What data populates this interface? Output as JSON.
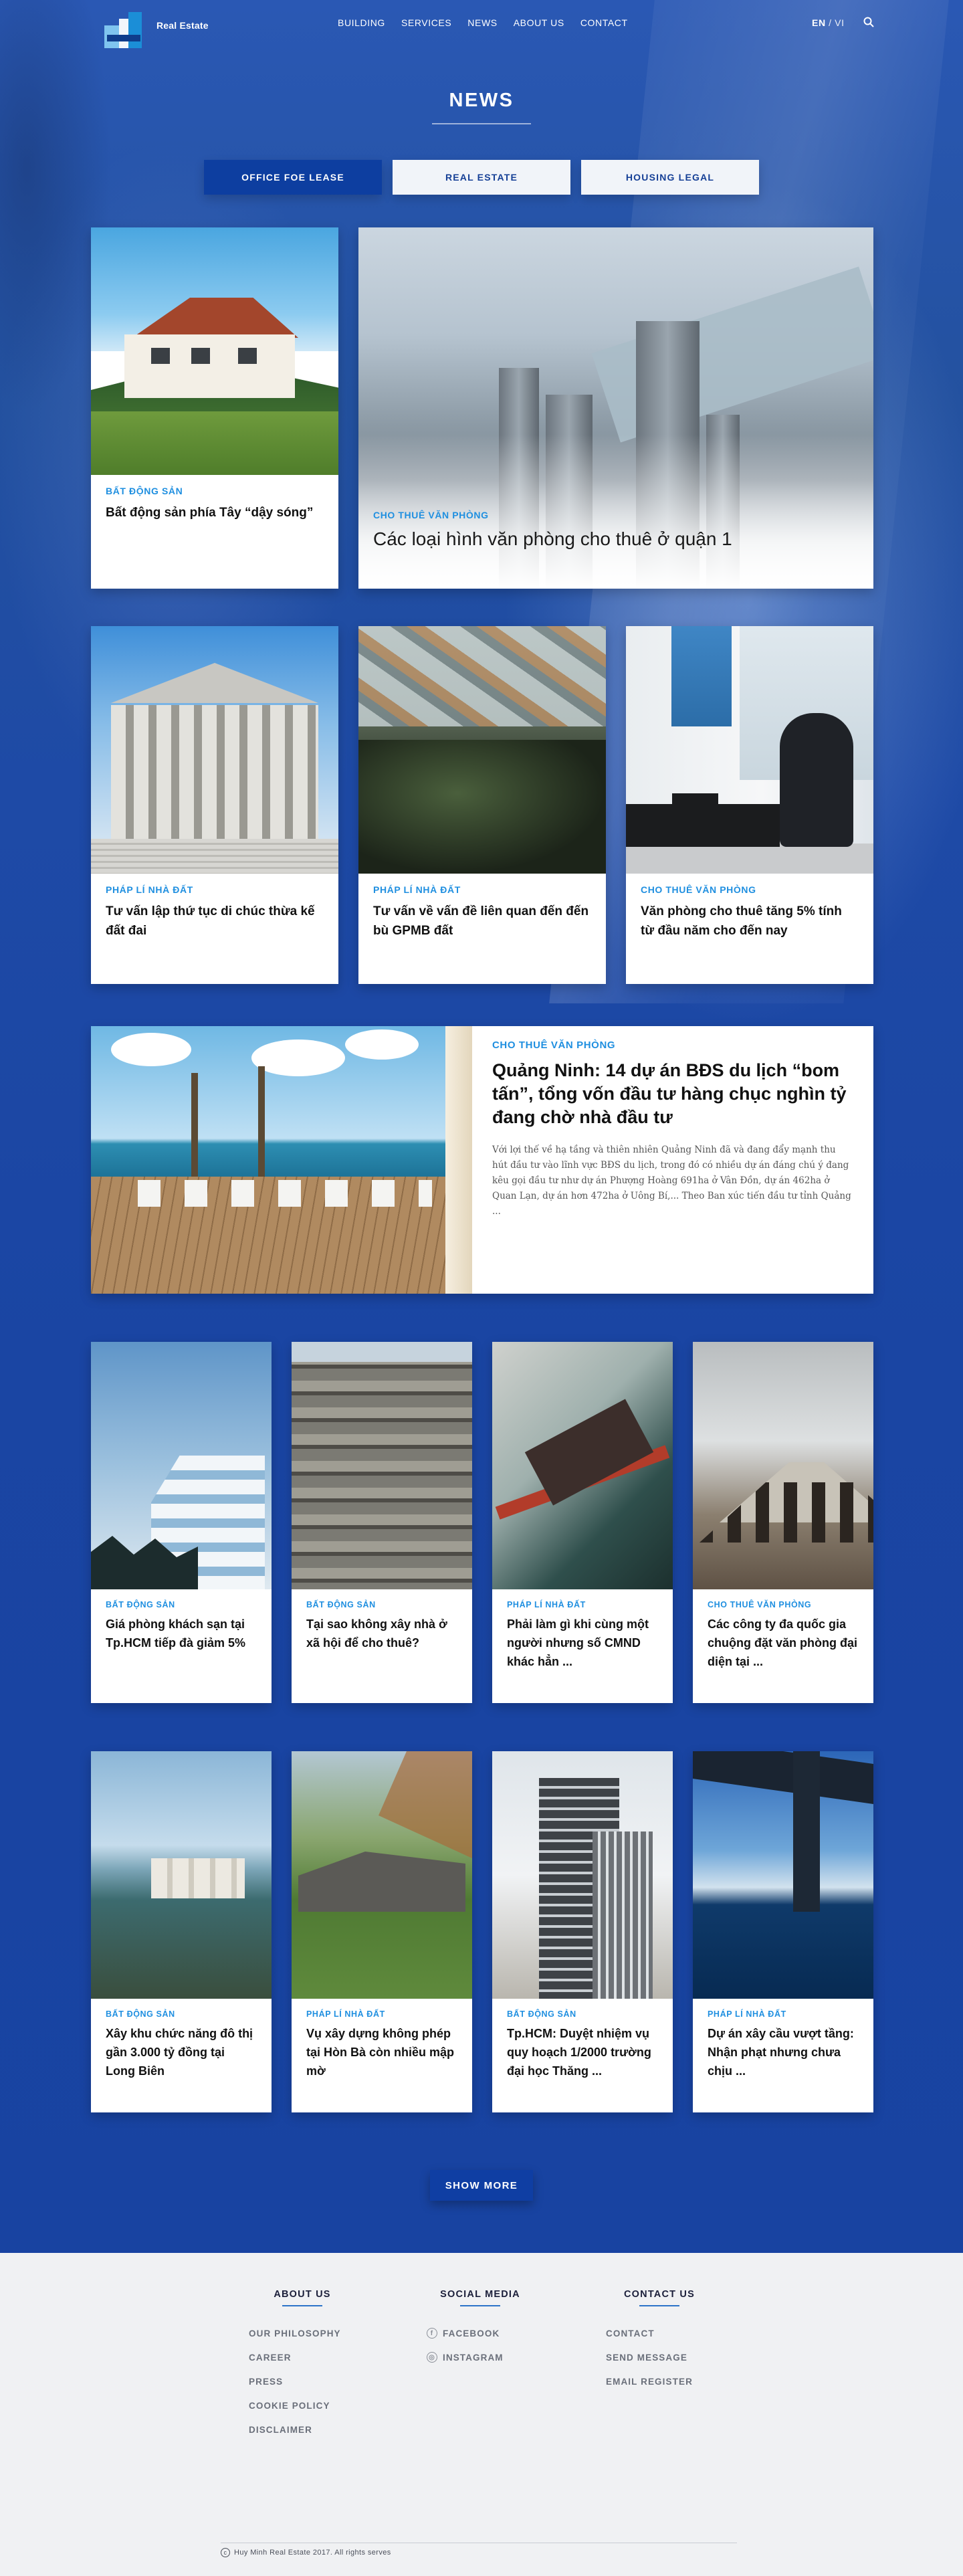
{
  "header": {
    "brand": "Real Estate",
    "nav": [
      "BUILDING",
      "SERVICES",
      "NEWS",
      "ABOUT US",
      "CONTACT"
    ],
    "lang_active": "EN",
    "lang_separator": "/",
    "lang_other": "VI"
  },
  "page_title": "NEWS",
  "tabs": [
    {
      "label": "OFFICE FOE LEASE",
      "active": true
    },
    {
      "label": "REAL ESTATE",
      "active": false
    },
    {
      "label": "HOUSING LEGAL",
      "active": false
    }
  ],
  "row1": [
    {
      "category": "BẤT ĐỘNG SẢN",
      "title": "Bất động sản phía Tây “dậy sóng”"
    },
    {
      "category": "CHO THUÊ VĂN PHÒNG",
      "title": "Các loại hình văn phòng cho thuê ở quận 1"
    }
  ],
  "row2": [
    {
      "category": "PHÁP LÍ NHÀ ĐẤT",
      "title": "Tư vấn lập thứ tục di chúc thừa kế đất đai"
    },
    {
      "category": "PHÁP LÍ NHÀ ĐẤT",
      "title": "Tư vấn về vấn đề liên quan đến đến bù GPMB đất"
    },
    {
      "category": "CHO THUÊ VĂN PHÒNG",
      "title": "Văn phòng cho thuê tăng 5% tính từ đầu năm cho đến nay"
    }
  ],
  "feature": {
    "category": "CHO THUÊ VĂN PHÒNG",
    "title": "Quảng Ninh: 14 dự án BĐS du lịch “bom tấn”, tổng vốn đầu tư hàng chục nghìn tỷ đang chờ nhà đầu tư",
    "excerpt": "Với lợi thế về hạ tầng và thiên nhiên Quảng Ninh đã và đang đẩy mạnh thu hút đầu tư vào lĩnh vực BĐS du lịch, trong đó có nhiều dự án đáng chú ý đang kêu gọi đầu tư như dự án Phượng Hoàng 691ha ở Vân Đồn, dự án 462ha ở Quan Lạn, dự án hơn 472ha ở Uông Bí,... Theo Ban xúc tiến đầu tư tỉnh Quảng ..."
  },
  "row3": [
    {
      "category": "BẤT ĐỘNG SẢN",
      "title": "Giá phòng khách sạn tại Tp.HCM tiếp đà giảm 5%"
    },
    {
      "category": "BẤT ĐỘNG SẢN",
      "title": "Tại sao không xây nhà ở xã hội để cho thuê?"
    },
    {
      "category": "PHÁP LÍ NHÀ ĐẤT",
      "title": "Phải làm gì khi cùng một người nhưng số CMND khác hẳn ..."
    },
    {
      "category": "CHO THUÊ VĂN PHÒNG",
      "title": "Các công ty đa quốc gia chuộng đặt văn phòng đại diện tại ..."
    }
  ],
  "row4": [
    {
      "category": "BẤT ĐỘNG SẢN",
      "title": "Xây khu chức năng đô thị gần 3.000 tỷ đồng tại Long Biên"
    },
    {
      "category": "PHÁP LÍ NHÀ ĐẤT",
      "title": "Vụ xây dựng không phép tại Hòn Bà còn nhiều mập mờ"
    },
    {
      "category": "BẤT ĐỘNG SẢN",
      "title": "Tp.HCM: Duyệt nhiệm vụ quy hoạch 1/2000 trường đại học Thăng ..."
    },
    {
      "category": "PHÁP LÍ NHÀ ĐẤT",
      "title": "Dự án xây cầu vượt tầng: Nhận phạt nhưng chưa chịu ..."
    }
  ],
  "show_more": "SHOW MORE",
  "footer": {
    "about_title": "ABOUT US",
    "about_links": [
      "OUR PHILOSOPHY",
      "CAREER",
      "PRESS",
      "COOKIE POLICY",
      "DISCLAIMER"
    ],
    "social_title": "SOCIAL MEDIA",
    "social_links": [
      "FACEBOOK",
      "INSTAGRAM"
    ],
    "contact_title": "CONTACT US",
    "contact_links": [
      "CONTACT",
      "SEND MESSAGE",
      "EMAIL REGISTER"
    ],
    "copyright": "Huy Minh Real Estate 2017. All rights serves"
  },
  "colors": {
    "primary_blue": "#1a45a3",
    "tab_active": "#0d3ea0",
    "category_blue": "#1f8fe0",
    "footer_bg": "#f0f1f3"
  }
}
